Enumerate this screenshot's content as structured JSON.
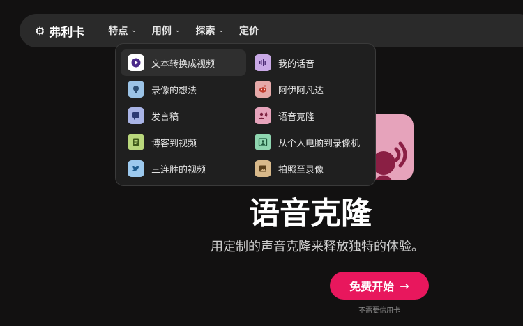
{
  "brand": {
    "name": "弗利卡",
    "icon": "gear-icon"
  },
  "nav": {
    "items": [
      {
        "label": "特点",
        "has_dropdown": true
      },
      {
        "label": "用例",
        "has_dropdown": true
      },
      {
        "label": "探索",
        "has_dropdown": true
      },
      {
        "label": "定价",
        "has_dropdown": false
      }
    ]
  },
  "dropdown": {
    "left": [
      {
        "label": "文本转换成视频",
        "icon": "play-icon",
        "color": "#ffffff",
        "active": true
      },
      {
        "label": "录像的想法",
        "icon": "lightbulb-icon",
        "color": "#9bc3e6"
      },
      {
        "label": "发言稿",
        "icon": "speech-bubble-icon",
        "color": "#a9b4e6"
      },
      {
        "label": "博客到视频",
        "icon": "document-icon",
        "color": "#b9d77c"
      },
      {
        "label": "三连胜的视频",
        "icon": "twitter-icon",
        "color": "#9cc9ee"
      }
    ],
    "right": [
      {
        "label": "我的话音",
        "icon": "waveform-icon",
        "color": "#c9a9e6"
      },
      {
        "label": "阿伊阿凡达",
        "icon": "reddit-icon",
        "color": "#e6a9a9"
      },
      {
        "label": "语音克隆",
        "icon": "voice-person-icon",
        "color": "#e6a3bb"
      },
      {
        "label": "从个人电脑到录像机",
        "icon": "person-card-icon",
        "color": "#8fd6b0"
      },
      {
        "label": "拍照至录像",
        "icon": "image-icon",
        "color": "#d8b98a"
      }
    ]
  },
  "hero": {
    "title": "语音克隆",
    "subtitle": "用定制的声音克隆来释放独特的体验。",
    "cta_label": "免费开始",
    "cta_arrow": "→",
    "note": "不需要信用卡",
    "accent": "#e8175d"
  }
}
